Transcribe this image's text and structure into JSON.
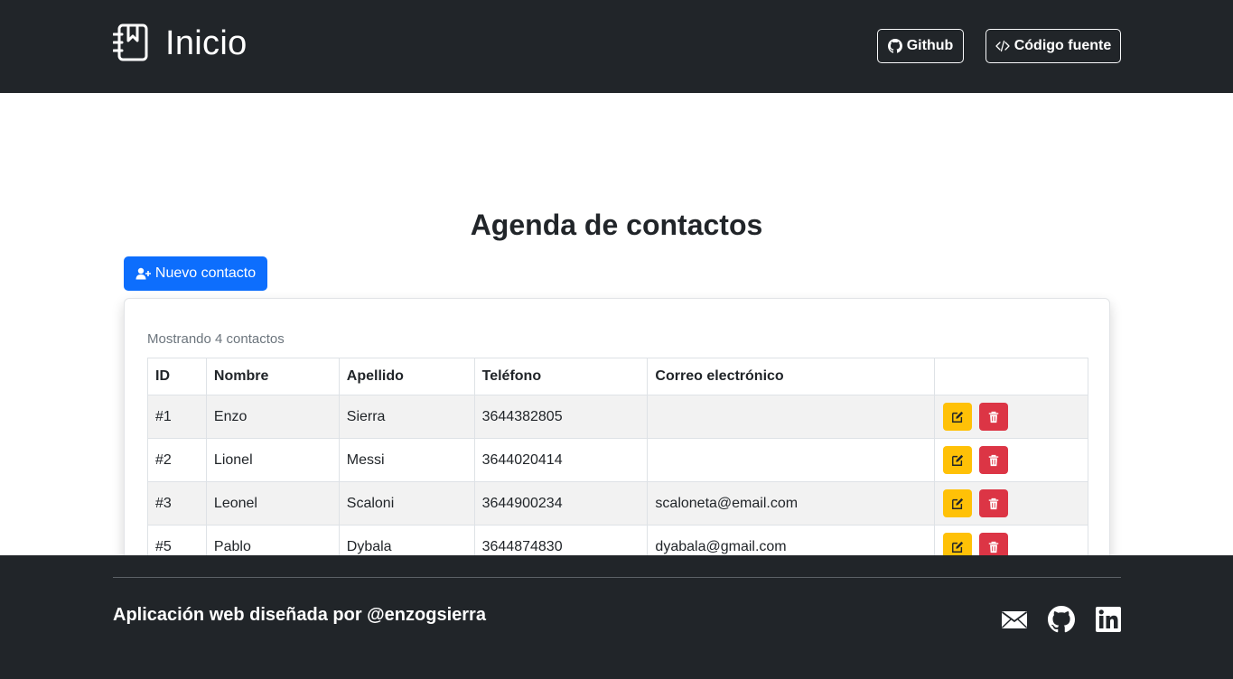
{
  "navbar": {
    "brand": "Inicio",
    "github_label": "Github",
    "source_label": "Código fuente"
  },
  "main": {
    "title": "Agenda de contactos",
    "new_contact_label": "Nuevo contacto",
    "count_text": "Mostrando 4 contactos"
  },
  "table": {
    "headers": [
      "ID",
      "Nombre",
      "Apellido",
      "Teléfono",
      "Correo electrónico",
      ""
    ],
    "rows": [
      {
        "id": "#1",
        "nombre": "Enzo",
        "apellido": "Sierra",
        "telefono": "3644382805",
        "correo": ""
      },
      {
        "id": "#2",
        "nombre": "Lionel",
        "apellido": "Messi",
        "telefono": "3644020414",
        "correo": ""
      },
      {
        "id": "#3",
        "nombre": "Leonel",
        "apellido": "Scaloni",
        "telefono": "3644900234",
        "correo": "scaloneta@email.com"
      },
      {
        "id": "#5",
        "nombre": "Pablo",
        "apellido": "Dybala",
        "telefono": "3644874830",
        "correo": "dyabala@gmail.com"
      }
    ]
  },
  "footer": {
    "text": "Aplicación web diseñada por @enzogsierra"
  },
  "icons": {
    "brand": "journal-bookmark-icon",
    "github": "github-icon",
    "source": "code-slash-icon",
    "new_contact": "person-plus-icon",
    "edit": "pencil-square-icon",
    "delete": "trash-icon",
    "mail": "envelope-icon",
    "linkedin": "linkedin-icon"
  },
  "colors": {
    "navbar_bg": "#212529",
    "primary": "#0d6efd",
    "warning": "#ffc107",
    "danger": "#dc3545",
    "stripe": "#f2f2f2"
  }
}
